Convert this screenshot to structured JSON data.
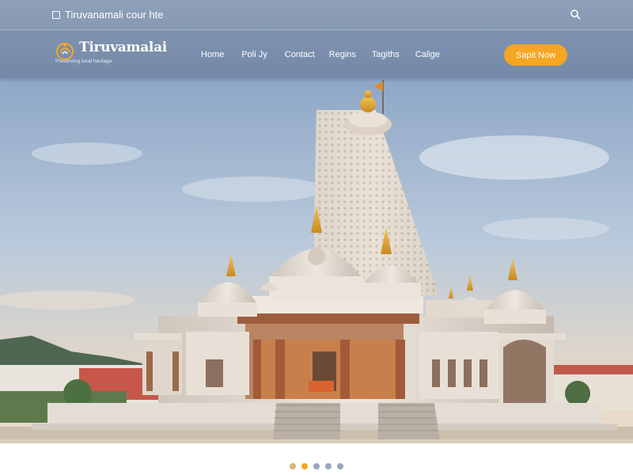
{
  "topbar": {
    "site_title": "Tiruvanamali cour hte"
  },
  "navbar": {
    "logo_name": "Tiruvamalai",
    "logo_tagline": "Preserving local heritage",
    "menu": [
      "Home",
      "Poli Jy",
      "Contact",
      "Regins",
      "Tagiths",
      "Calige"
    ],
    "cta_label": "Sapit Now"
  },
  "colors": {
    "accent": "#f5a623",
    "nav_bg": "#7f93b0",
    "dot_active": "#f5a623",
    "dot_inactive": "#9aa6ba"
  },
  "carousel": {
    "slide_count": 5,
    "active_index": 1
  }
}
